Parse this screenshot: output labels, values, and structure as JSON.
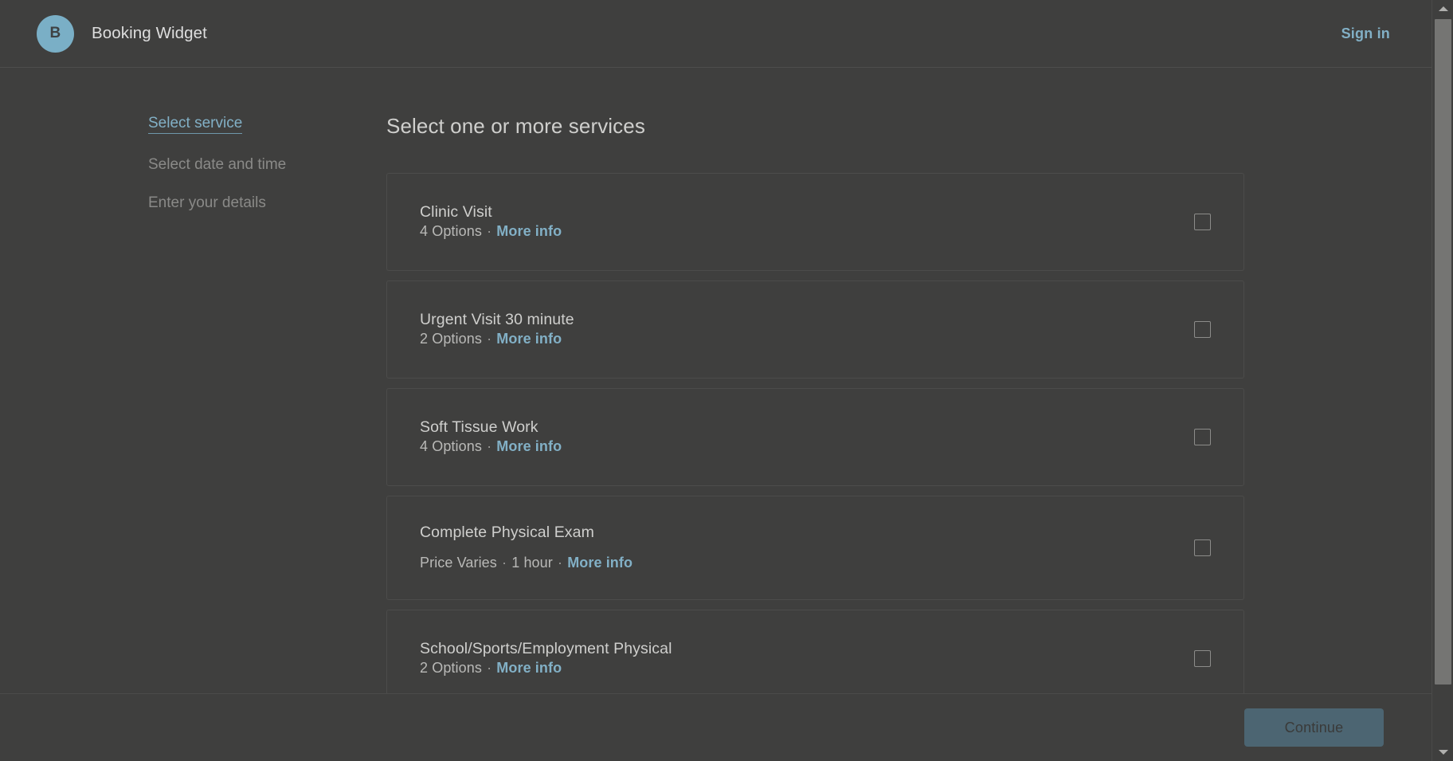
{
  "header": {
    "brand_initial": "B",
    "brand_title": "Booking Widget",
    "signin_label": "Sign in"
  },
  "steps": [
    {
      "label": "Select service",
      "state": "active"
    },
    {
      "label": "Select date and time",
      "state": "inactive"
    },
    {
      "label": "Enter your details",
      "state": "inactive"
    }
  ],
  "main": {
    "section_title": "Select one or more services",
    "more_info_label": "More info",
    "separator": "·"
  },
  "services": [
    {
      "name": "Clinic Visit",
      "options": "4 Options",
      "duration": "",
      "price": ""
    },
    {
      "name": "Urgent Visit 30 minute",
      "options": "2 Options",
      "duration": "",
      "price": ""
    },
    {
      "name": "Soft Tissue Work",
      "options": "4 Options",
      "duration": "",
      "price": ""
    },
    {
      "name": "Complete Physical Exam",
      "options": "",
      "duration": "1 hour",
      "price": "Price Varies"
    },
    {
      "name": "School/Sports/Employment Physical",
      "options": "2 Options",
      "duration": "",
      "price": ""
    }
  ],
  "footer": {
    "continue_label": "Continue"
  },
  "colors": {
    "page_background": "#3f3f3e",
    "accent_blue": "#82b0c6",
    "avatar_blue": "#7aafc6",
    "continue_button": "#4c6572",
    "card_border": "#4c4c4b"
  }
}
